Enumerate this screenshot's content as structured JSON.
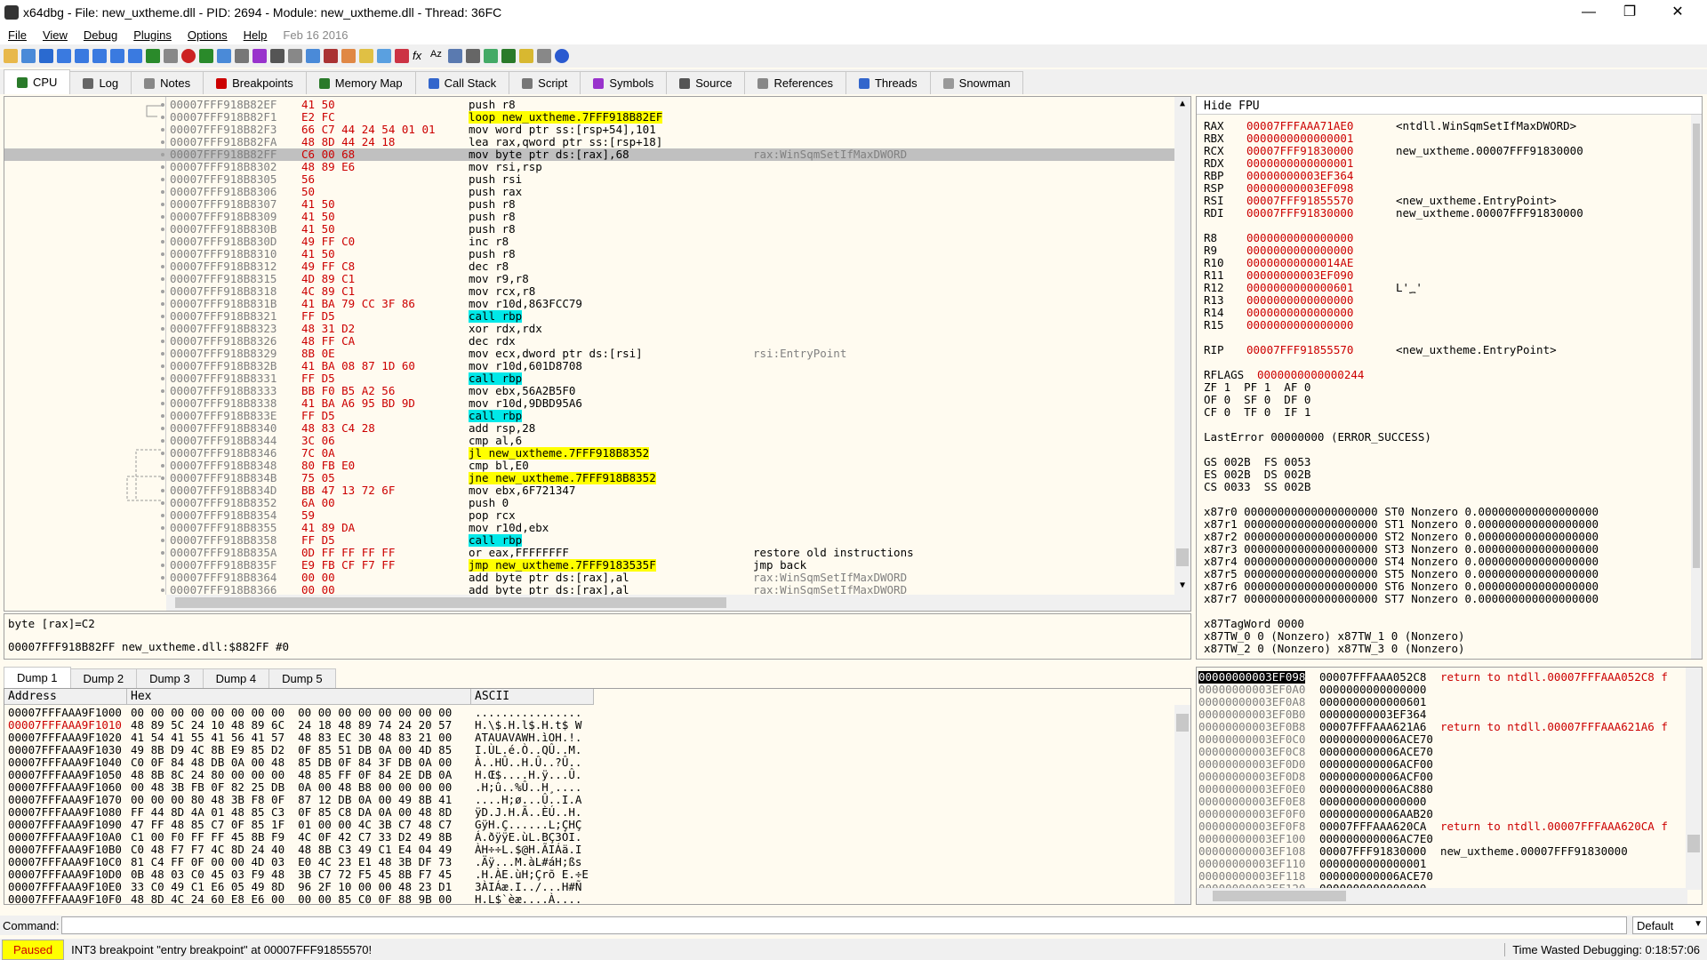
{
  "window": {
    "title": "x64dbg - File: new_uxtheme.dll - PID: 2694 - Module: new_uxtheme.dll - Thread: 36FC"
  },
  "menu": {
    "items": [
      "File",
      "View",
      "Debug",
      "Plugins",
      "Options",
      "Help"
    ],
    "date": "Feb 16 2016"
  },
  "tabs": [
    {
      "label": "CPU",
      "color": "#2a7a2a"
    },
    {
      "label": "Log",
      "color": "#666"
    },
    {
      "label": "Notes",
      "color": "#888"
    },
    {
      "label": "Breakpoints",
      "color": "#cc0000"
    },
    {
      "label": "Memory Map",
      "color": "#2a7a2a"
    },
    {
      "label": "Call Stack",
      "color": "#3366cc"
    },
    {
      "label": "Script",
      "color": "#777"
    },
    {
      "label": "Symbols",
      "color": "#9933cc"
    },
    {
      "label": "Source",
      "color": "#555"
    },
    {
      "label": "References",
      "color": "#888"
    },
    {
      "label": "Threads",
      "color": "#3366cc"
    },
    {
      "label": "Snowman",
      "color": "#999"
    }
  ],
  "disasm": [
    {
      "a": "00007FFF918B82EF",
      "b": "41 50",
      "i": "push r8",
      "c": ""
    },
    {
      "a": "00007FFF918B82F1",
      "b": "E2 FC",
      "i": "loop new_uxtheme.7FFF918B82EF",
      "c": "",
      "k": "jmp"
    },
    {
      "a": "00007FFF918B82F3",
      "b": "66 C7 44 24 54 01 01",
      "i": "mov word ptr ss:[rsp+54],101",
      "c": ""
    },
    {
      "a": "00007FFF918B82FA",
      "b": "48 8D 44 24 18",
      "i": "lea rax,qword ptr ss:[rsp+18]",
      "c": ""
    },
    {
      "a": "00007FFF918B82FF",
      "b": "C6 00 68",
      "i": "mov byte ptr ds:[rax],68",
      "c": "rax:WinSqmSetIfMaxDWORD",
      "hl": true
    },
    {
      "a": "00007FFF918B8302",
      "b": "48 89 E6",
      "i": "mov rsi,rsp",
      "c": ""
    },
    {
      "a": "00007FFF918B8305",
      "b": "56",
      "i": "push rsi",
      "c": ""
    },
    {
      "a": "00007FFF918B8306",
      "b": "50",
      "i": "push rax",
      "c": ""
    },
    {
      "a": "00007FFF918B8307",
      "b": "41 50",
      "i": "push r8",
      "c": ""
    },
    {
      "a": "00007FFF918B8309",
      "b": "41 50",
      "i": "push r8",
      "c": ""
    },
    {
      "a": "00007FFF918B830B",
      "b": "41 50",
      "i": "push r8",
      "c": ""
    },
    {
      "a": "00007FFF918B830D",
      "b": "49 FF C0",
      "i": "inc r8",
      "c": ""
    },
    {
      "a": "00007FFF918B8310",
      "b": "41 50",
      "i": "push r8",
      "c": ""
    },
    {
      "a": "00007FFF918B8312",
      "b": "49 FF C8",
      "i": "dec r8",
      "c": ""
    },
    {
      "a": "00007FFF918B8315",
      "b": "4D 89 C1",
      "i": "mov r9,r8",
      "c": ""
    },
    {
      "a": "00007FFF918B8318",
      "b": "4C 89 C1",
      "i": "mov rcx,r8",
      "c": ""
    },
    {
      "a": "00007FFF918B831B",
      "b": "41 BA 79 CC 3F 86",
      "i": "mov r10d,863FCC79",
      "c": ""
    },
    {
      "a": "00007FFF918B8321",
      "b": "FF D5",
      "i": "call rbp",
      "c": "",
      "k": "call"
    },
    {
      "a": "00007FFF918B8323",
      "b": "48 31 D2",
      "i": "xor rdx,rdx",
      "c": ""
    },
    {
      "a": "00007FFF918B8326",
      "b": "48 FF CA",
      "i": "dec rdx",
      "c": ""
    },
    {
      "a": "00007FFF918B8329",
      "b": "8B 0E",
      "i": "mov ecx,dword ptr ds:[rsi]",
      "c": "rsi:EntryPoint"
    },
    {
      "a": "00007FFF918B832B",
      "b": "41 BA 08 87 1D 60",
      "i": "mov r10d,601D8708",
      "c": ""
    },
    {
      "a": "00007FFF918B8331",
      "b": "FF D5",
      "i": "call rbp",
      "c": "",
      "k": "call"
    },
    {
      "a": "00007FFF918B8333",
      "b": "BB F0 B5 A2 56",
      "i": "mov ebx,56A2B5F0",
      "c": ""
    },
    {
      "a": "00007FFF918B8338",
      "b": "41 BA A6 95 BD 9D",
      "i": "mov r10d,9DBD95A6",
      "c": ""
    },
    {
      "a": "00007FFF918B833E",
      "b": "FF D5",
      "i": "call rbp",
      "c": "",
      "k": "call"
    },
    {
      "a": "00007FFF918B8340",
      "b": "48 83 C4 28",
      "i": "add rsp,28",
      "c": ""
    },
    {
      "a": "00007FFF918B8344",
      "b": "3C 06",
      "i": "cmp al,6",
      "c": ""
    },
    {
      "a": "00007FFF918B8346",
      "b": "7C 0A",
      "i": "jl new_uxtheme.7FFF918B8352",
      "c": "",
      "k": "jmp"
    },
    {
      "a": "00007FFF918B8348",
      "b": "80 FB E0",
      "i": "cmp bl,E0",
      "c": ""
    },
    {
      "a": "00007FFF918B834B",
      "b": "75 05",
      "i": "jne new_uxtheme.7FFF918B8352",
      "c": "",
      "k": "jmp"
    },
    {
      "a": "00007FFF918B834D",
      "b": "BB 47 13 72 6F",
      "i": "mov ebx,6F721347",
      "c": ""
    },
    {
      "a": "00007FFF918B8352",
      "b": "6A 00",
      "i": "push 0",
      "c": ""
    },
    {
      "a": "00007FFF918B8354",
      "b": "59",
      "i": "pop rcx",
      "c": ""
    },
    {
      "a": "00007FFF918B8355",
      "b": "41 89 DA",
      "i": "mov r10d,ebx",
      "c": ""
    },
    {
      "a": "00007FFF918B8358",
      "b": "FF D5",
      "i": "call rbp",
      "c": "",
      "k": "call"
    },
    {
      "a": "00007FFF918B835A",
      "b": "0D FF FF FF FF",
      "i": "or eax,FFFFFFFF",
      "c": "restore old instructions"
    },
    {
      "a": "00007FFF918B835F",
      "b": "E9 FB CF F7 FF",
      "i": "jmp new_uxtheme.7FFF9183535F",
      "c": "jmp back",
      "k": "jmp"
    },
    {
      "a": "00007FFF918B8364",
      "b": "00 00",
      "i": "add byte ptr ds:[rax],al",
      "c": "rax:WinSqmSetIfMaxDWORD",
      "cg": true
    },
    {
      "a": "00007FFF918B8366",
      "b": "00 00",
      "i": "add byte ptr ds:[rax],al",
      "c": "rax:WinSqmSetIfMaxDWORD",
      "cg": true
    }
  ],
  "info": {
    "line1": "byte [rax]=C2",
    "line2": "00007FFF918B82FF new_uxtheme.dll:$882FF #0"
  },
  "regs": {
    "hide_fpu": "Hide FPU",
    "gp": [
      {
        "n": "RAX",
        "v": "00007FFFAAA71AE0",
        "c": "<ntdll.WinSqmSetIfMaxDWORD>"
      },
      {
        "n": "RBX",
        "v": "0000000000000001",
        "c": ""
      },
      {
        "n": "RCX",
        "v": "00007FFF91830000",
        "c": "new_uxtheme.00007FFF91830000"
      },
      {
        "n": "RDX",
        "v": "0000000000000001",
        "c": ""
      },
      {
        "n": "RBP",
        "v": "00000000003EF364",
        "c": ""
      },
      {
        "n": "RSP",
        "v": "00000000003EF098",
        "c": ""
      },
      {
        "n": "RSI",
        "v": "00007FFF91855570",
        "c": "<new_uxtheme.EntryPoint>"
      },
      {
        "n": "RDI",
        "v": "00007FFF91830000",
        "c": "new_uxtheme.00007FFF91830000"
      }
    ],
    "ext": [
      {
        "n": "R8",
        "v": "0000000000000000",
        "c": ""
      },
      {
        "n": "R9",
        "v": "0000000000000000",
        "c": ""
      },
      {
        "n": "R10",
        "v": "00000000000014AE",
        "c": ""
      },
      {
        "n": "R11",
        "v": "00000000003EF090",
        "c": ""
      },
      {
        "n": "R12",
        "v": "0000000000000601",
        "c": "L'؁'"
      },
      {
        "n": "R13",
        "v": "0000000000000000",
        "c": ""
      },
      {
        "n": "R14",
        "v": "0000000000000000",
        "c": ""
      },
      {
        "n": "R15",
        "v": "0000000000000000",
        "c": ""
      }
    ],
    "rip": {
      "n": "RIP",
      "v": "00007FFF91855570",
      "c": "<new_uxtheme.EntryPoint>"
    },
    "rflags": {
      "n": "RFLAGS",
      "v": "0000000000000244"
    },
    "flags": [
      "ZF 1  PF 1  AF 0",
      "OF 0  SF 0  DF 0",
      "CF 0  TF 0  IF 1"
    ],
    "lasterror": "LastError 00000000 (ERROR_SUCCESS)",
    "segs": [
      "GS 002B  FS 0053",
      "ES 002B  DS 002B",
      "CS 0033  SS 002B"
    ],
    "fpu": [
      "x87r0 00000000000000000000 ST0 Nonzero 0.000000000000000000",
      "x87r1 00000000000000000000 ST1 Nonzero 0.000000000000000000",
      "x87r2 00000000000000000000 ST2 Nonzero 0.000000000000000000",
      "x87r3 00000000000000000000 ST3 Nonzero 0.000000000000000000",
      "x87r4 00000000000000000000 ST4 Nonzero 0.000000000000000000",
      "x87r5 00000000000000000000 ST5 Nonzero 0.000000000000000000",
      "x87r6 00000000000000000000 ST6 Nonzero 0.000000000000000000",
      "x87r7 00000000000000000000 ST7 Nonzero 0.000000000000000000"
    ],
    "tag": [
      "x87TagWord 0000",
      "x87TW_0 0 (Nonzero) x87TW_1 0 (Nonzero)",
      "x87TW_2 0 (Nonzero) x87TW_3 0 (Nonzero)"
    ]
  },
  "dump_tabs": [
    "Dump 1",
    "Dump 2",
    "Dump 3",
    "Dump 4",
    "Dump 5"
  ],
  "dump": {
    "headers": [
      "Address",
      "Hex",
      "ASCII"
    ],
    "rows": [
      {
        "a": "00007FFFAAA9F1000",
        "h": "00 00 00 00 00 00 00 00  00 00 00 00 00 00 00 00",
        "s": "................"
      },
      {
        "a": "00007FFFAAA9F1010",
        "h": "48 89 5C 24 10 48 89 6C  24 18 48 89 74 24 20 57",
        "s": "H.\\$.H.l$.H.t$ W",
        "red": true
      },
      {
        "a": "00007FFFAAA9F1020",
        "h": "41 54 41 55 41 56 41 57  48 83 EC 30 48 83 21 00",
        "s": "ATAUAVAWH.ìOH.!."
      },
      {
        "a": "00007FFFAAA9F1030",
        "h": "49 8B D9 4C 8B E9 85 D2  0F 85 51 DB 0A 00 4D 85",
        "s": "I.ÙL.é.Ò..QÛ..M."
      },
      {
        "a": "00007FFFAAA9F1040",
        "h": "C0 0F 84 48 DB 0A 00 48  85 DB 0F 84 3F DB 0A 00",
        "s": "À..HÛ..H.Û..?Û.."
      },
      {
        "a": "00007FFFAAA9F1050",
        "h": "48 8B 8C 24 80 00 00 00  48 85 FF 0F 84 2E DB 0A",
        "s": "H.Œ$....H.ÿ...Û."
      },
      {
        "a": "00007FFFAAA9F1060",
        "h": "00 48 3B FB 0F 82 25 DB  0A 00 48 B8 00 00 00 00",
        "s": ".H;û..%Û..H¸...."
      },
      {
        "a": "00007FFFAAA9F1070",
        "h": "00 00 00 80 48 3B F8 0F  87 12 DB 0A 00 49 8B 41",
        "s": "....H;ø...Û..I.A"
      },
      {
        "a": "00007FFFAAA9F1080",
        "h": "FF 44 8D 4A 01 48 85 C3  0F 85 C8 DA 0A 00 48 8D",
        "s": "ÿD.J.H.Ã..ÈÚ..H."
      },
      {
        "a": "00007FFFAAA9F1090",
        "h": "47 FF 48 85 C7 0F 85 1F  01 00 00 4C 3B C7 48 C7",
        "s": "GÿH.Ç......L;ÇHÇ"
      },
      {
        "a": "00007FFFAAA9F10A0",
        "h": "C1 00 F0 FF FF 45 8B F9  4C 0F 42 C7 33 D2 49 8B",
        "s": "Á.ðÿÿE.ùL.BÇ3ÒI."
      },
      {
        "a": "00007FFFAAA9F10B0",
        "h": "C0 48 F7 F7 4C 8D 24 40  48 8B C3 49 C1 E4 04 49",
        "s": "ÀH÷÷L.$@H.ÃIÁä.I"
      },
      {
        "a": "00007FFFAAA9F10C0",
        "h": "81 C4 FF 0F 00 00 4D 03  E0 4C 23 E1 48 3B DF 73",
        "s": ".Äÿ...M.àL#áH;ßs"
      },
      {
        "a": "00007FFFAAA9F10D0",
        "h": "0B 48 03 C0 45 03 F9 48  3B C7 72 F5 45 8B F7 45",
        "s": ".H.ÀE.ùH;Çrõ E.÷E"
      },
      {
        "a": "00007FFFAAA9F10E0",
        "h": "33 C0 49 C1 E6 05 49 8D  96 2F 10 00 00 48 23 D1",
        "s": "3ÀIÁæ.I../...H#Ñ"
      },
      {
        "a": "00007FFFAAA9F10F0",
        "h": "48 8D 4C 24 60 E8 E6 00  00 00 85 C0 0F 88 9B 00",
        "s": "H.L$`èæ....À...."
      }
    ]
  },
  "stack": [
    {
      "a": "00000000003EF098",
      "v": "00007FFFAAA052C8",
      "c": "return to ntdll.00007FFFAAA052C8 f",
      "sel": true,
      "red": true
    },
    {
      "a": "00000000003EF0A0",
      "v": "0000000000000000",
      "c": ""
    },
    {
      "a": "00000000003EF0A8",
      "v": "0000000000000601",
      "c": ""
    },
    {
      "a": "00000000003EF0B0",
      "v": "00000000003EF364",
      "c": ""
    },
    {
      "a": "00000000003EF0B8",
      "v": "00007FFFAAA621A6",
      "c": "return to ntdll.00007FFFAAA621A6 f",
      "red": true
    },
    {
      "a": "00000000003EF0C0",
      "v": "000000000006ACE70",
      "c": ""
    },
    {
      "a": "00000000003EF0C8",
      "v": "000000000006ACE70",
      "c": ""
    },
    {
      "a": "00000000003EF0D0",
      "v": "000000000006ACF00",
      "c": ""
    },
    {
      "a": "00000000003EF0D8",
      "v": "000000000006ACF00",
      "c": ""
    },
    {
      "a": "00000000003EF0E0",
      "v": "000000000006AC880",
      "c": ""
    },
    {
      "a": "00000000003EF0E8",
      "v": "0000000000000000",
      "c": ""
    },
    {
      "a": "00000000003EF0F0",
      "v": "000000000006AAB20",
      "c": ""
    },
    {
      "a": "00000000003EF0F8",
      "v": "00007FFFAAA620CA",
      "c": "return to ntdll.00007FFFAAA620CA f",
      "red": true
    },
    {
      "a": "00000000003EF100",
      "v": "000000000006AC7E0",
      "c": ""
    },
    {
      "a": "00000000003EF108",
      "v": "00007FFF91830000",
      "c": "new_uxtheme.00007FFF91830000"
    },
    {
      "a": "00000000003EF110",
      "v": "0000000000000001",
      "c": ""
    },
    {
      "a": "00000000003EF118",
      "v": "000000000006ACE70",
      "c": ""
    },
    {
      "a": "00000000003EF120",
      "v": "0000000000000000",
      "c": ""
    }
  ],
  "command": {
    "label": "Command:",
    "default": "Default"
  },
  "status": {
    "state": "Paused",
    "message": "INT3 breakpoint \"entry breakpoint\" at 00007FFF91855570!",
    "time": "Time Wasted Debugging: 0:18:57:06"
  }
}
